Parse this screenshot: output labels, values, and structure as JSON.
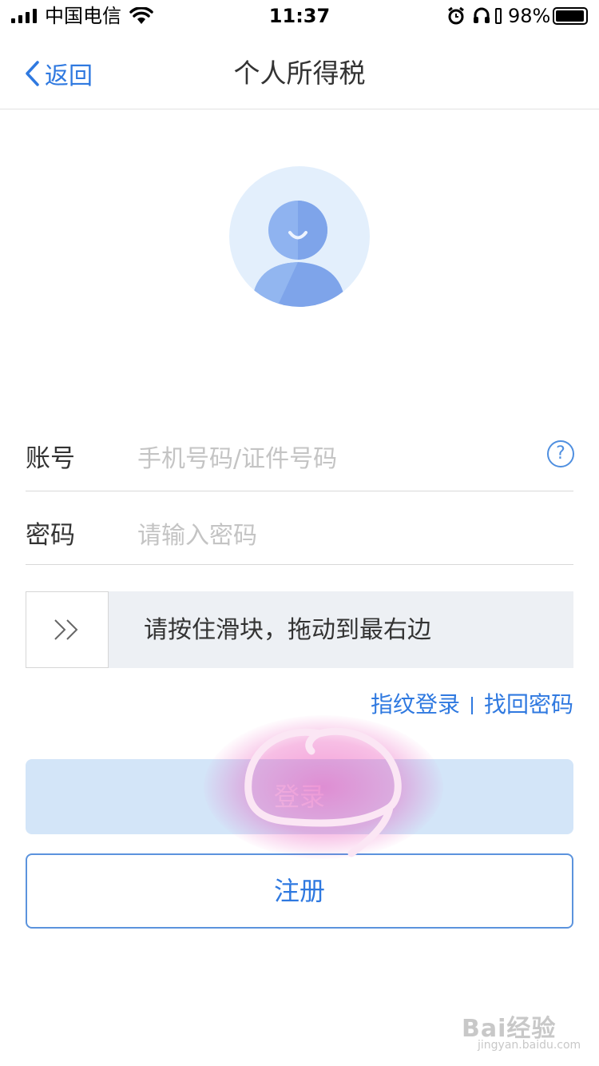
{
  "status_bar": {
    "carrier": "中国电信",
    "time": "11:37",
    "battery": "98%",
    "battery_level": 0.98,
    "icons": [
      "signal-icon",
      "wifi-icon",
      "alarm-icon",
      "headphones-icon",
      "battery-icon"
    ]
  },
  "nav": {
    "back_label": "返回",
    "title": "个人所得税"
  },
  "form": {
    "account_label": "账号",
    "account_placeholder": "手机号码/证件号码",
    "help_symbol": "?",
    "password_label": "密码",
    "password_placeholder": "请输入密码",
    "slider_text": "请按住滑块，拖动到最右边"
  },
  "links": {
    "fingerprint": "指纹登录",
    "recover": "找回密码"
  },
  "buttons": {
    "login": "登录",
    "register": "注册"
  },
  "watermark": {
    "brand": "Bai经验",
    "url": "jingyan.baidu.com"
  },
  "colors": {
    "accent": "#2f79e0",
    "login_disabled_bg": "#d3e5f8",
    "annotation": "#e846b4"
  }
}
